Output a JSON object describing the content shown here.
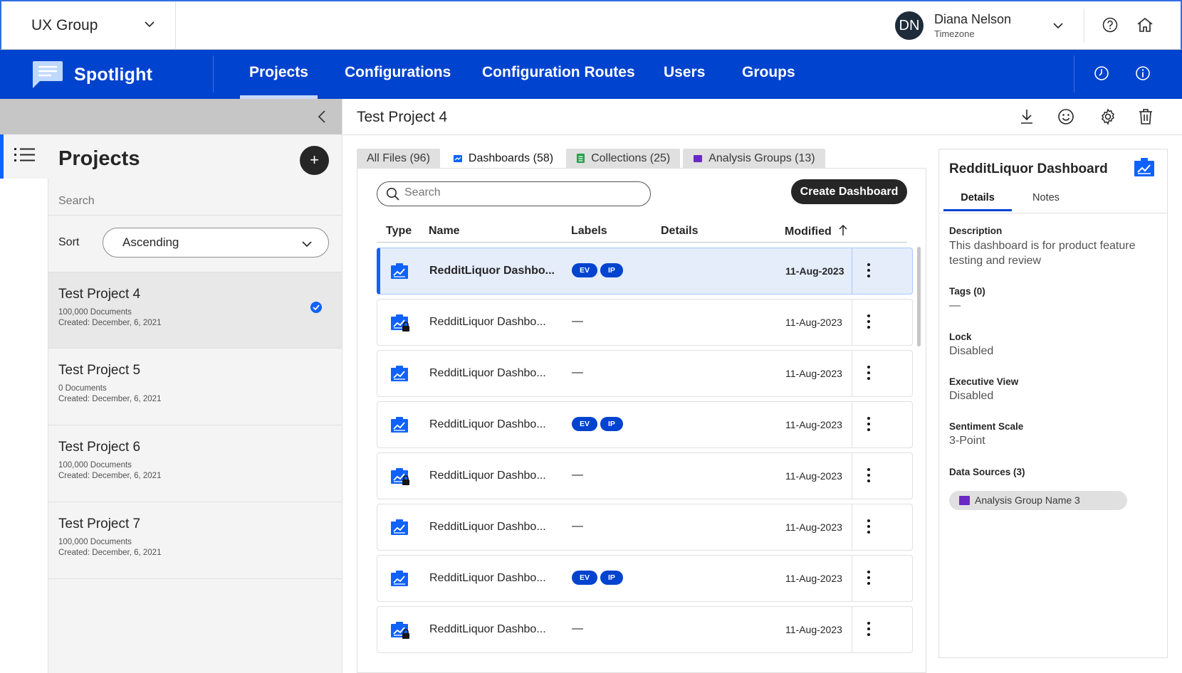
{
  "topbar": {
    "org_name": "UX Group",
    "user_initials": "DN",
    "user_name": "Diana Nelson",
    "user_sub": "Timezone",
    "icons": [
      "chevron-down-icon",
      "help-icon",
      "home-icon"
    ]
  },
  "nav": {
    "brand": "Spotlight",
    "items": [
      "Projects",
      "Configurations",
      "Configuration Routes",
      "Users",
      "Groups"
    ],
    "active": "Projects",
    "icons": [
      "history-icon",
      "info-icon"
    ],
    "colors": {
      "nav_bg": "#0043ce",
      "accent": "#0f62fe"
    }
  },
  "projects_panel": {
    "title": "Projects",
    "add_label": "+",
    "search_placeholder": "Search",
    "sort_label": "Sort",
    "sort_value": "Ascending",
    "projects": [
      {
        "name": "Test Project 4",
        "docs": "100,000 Documents",
        "created": "Created: December, 6, 2021",
        "selected": true
      },
      {
        "name": "Test Project 5",
        "docs": "0 Documents",
        "created": "Created: December, 6, 2021",
        "selected": false
      },
      {
        "name": "Test Project 6",
        "docs": "100,000 Documents",
        "created": "Created: December, 6, 2021",
        "selected": false
      },
      {
        "name": "Test Project 7",
        "docs": "100,000 Documents",
        "created": "Created: December, 6, 2021",
        "selected": false
      }
    ]
  },
  "main": {
    "title": "Test Project 4",
    "toolbar_icons": [
      "download-icon",
      "smile-icon",
      "settings-icon",
      "trash-icon"
    ],
    "tabs": [
      {
        "label": "All Files (96)",
        "icon": ""
      },
      {
        "label": "Dashboards (58)",
        "icon": "dashboard-icon"
      },
      {
        "label": "Collections (25)",
        "icon": "collection-icon"
      },
      {
        "label": "Analysis Groups (13)",
        "icon": "analysis-group-icon"
      }
    ],
    "active_tab": "Dashboards (58)",
    "search_placeholder": "Search",
    "create_label": "Create Dashboard",
    "columns": [
      "Type",
      "Name",
      "Labels",
      "Details",
      "Modified"
    ],
    "sort_indicator": "arrow-up-icon",
    "rows": [
      {
        "name": "RedditLiquor Dashbo...",
        "labels": [
          "EV",
          "IP"
        ],
        "date": "11-Aug-2023",
        "locked": false,
        "selected": true
      },
      {
        "name": "RedditLiquor Dashbo...",
        "labels": [],
        "date": "11-Aug-2023",
        "locked": true,
        "selected": false
      },
      {
        "name": "RedditLiquor Dashbo...",
        "labels": [],
        "date": "11-Aug-2023",
        "locked": false,
        "selected": false
      },
      {
        "name": "RedditLiquor Dashbo...",
        "labels": [
          "EV",
          "IP"
        ],
        "date": "11-Aug-2023",
        "locked": false,
        "selected": false
      },
      {
        "name": "RedditLiquor Dashbo...",
        "labels": [],
        "date": "11-Aug-2023",
        "locked": true,
        "selected": false
      },
      {
        "name": "RedditLiquor Dashbo...",
        "labels": [],
        "date": "11-Aug-2023",
        "locked": false,
        "selected": false
      },
      {
        "name": "RedditLiquor Dashbo...",
        "labels": [
          "EV",
          "IP"
        ],
        "date": "11-Aug-2023",
        "locked": false,
        "selected": false
      },
      {
        "name": "RedditLiquor Dashbo...",
        "labels": [],
        "date": "11-Aug-2023",
        "locked": true,
        "selected": false
      }
    ],
    "empty_label": "—"
  },
  "details": {
    "title": "RedditLiquor Dashboard",
    "tabs": [
      "Details",
      "Notes"
    ],
    "active_tab": "Details",
    "fields": [
      {
        "label": "Description",
        "value": "This dashboard is for product feature testing and review"
      },
      {
        "label": "Tags (0)",
        "value": "—"
      },
      {
        "label": "Lock",
        "value": "Disabled"
      },
      {
        "label": "Executive View",
        "value": "Disabled"
      },
      {
        "label": "Sentiment Scale",
        "value": "3-Point"
      },
      {
        "label": "Data Sources (3)",
        "value": ""
      }
    ],
    "data_source": "Analysis Group Name 3"
  }
}
